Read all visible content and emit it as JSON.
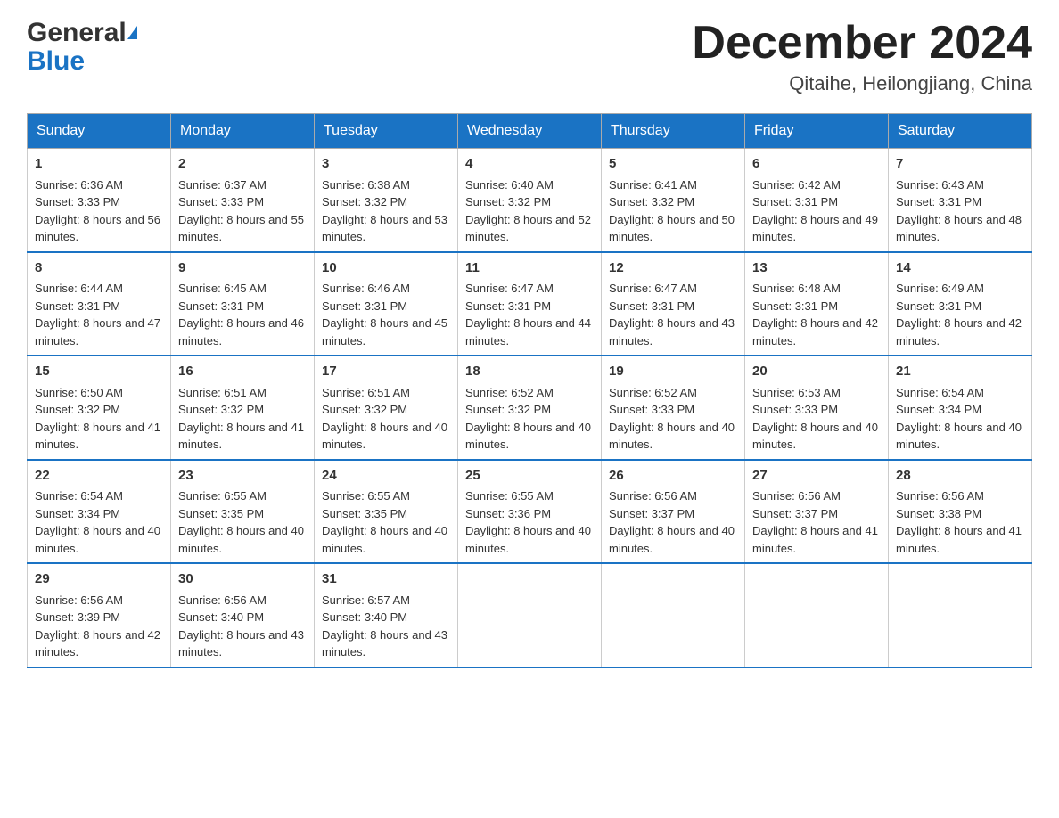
{
  "header": {
    "logo_general": "General",
    "logo_blue": "Blue",
    "month_title": "December 2024",
    "location": "Qitaihe, Heilongjiang, China"
  },
  "days_of_week": [
    "Sunday",
    "Monday",
    "Tuesday",
    "Wednesday",
    "Thursday",
    "Friday",
    "Saturday"
  ],
  "weeks": [
    [
      {
        "day": "1",
        "sunrise": "Sunrise: 6:36 AM",
        "sunset": "Sunset: 3:33 PM",
        "daylight": "Daylight: 8 hours and 56 minutes."
      },
      {
        "day": "2",
        "sunrise": "Sunrise: 6:37 AM",
        "sunset": "Sunset: 3:33 PM",
        "daylight": "Daylight: 8 hours and 55 minutes."
      },
      {
        "day": "3",
        "sunrise": "Sunrise: 6:38 AM",
        "sunset": "Sunset: 3:32 PM",
        "daylight": "Daylight: 8 hours and 53 minutes."
      },
      {
        "day": "4",
        "sunrise": "Sunrise: 6:40 AM",
        "sunset": "Sunset: 3:32 PM",
        "daylight": "Daylight: 8 hours and 52 minutes."
      },
      {
        "day": "5",
        "sunrise": "Sunrise: 6:41 AM",
        "sunset": "Sunset: 3:32 PM",
        "daylight": "Daylight: 8 hours and 50 minutes."
      },
      {
        "day": "6",
        "sunrise": "Sunrise: 6:42 AM",
        "sunset": "Sunset: 3:31 PM",
        "daylight": "Daylight: 8 hours and 49 minutes."
      },
      {
        "day": "7",
        "sunrise": "Sunrise: 6:43 AM",
        "sunset": "Sunset: 3:31 PM",
        "daylight": "Daylight: 8 hours and 48 minutes."
      }
    ],
    [
      {
        "day": "8",
        "sunrise": "Sunrise: 6:44 AM",
        "sunset": "Sunset: 3:31 PM",
        "daylight": "Daylight: 8 hours and 47 minutes."
      },
      {
        "day": "9",
        "sunrise": "Sunrise: 6:45 AM",
        "sunset": "Sunset: 3:31 PM",
        "daylight": "Daylight: 8 hours and 46 minutes."
      },
      {
        "day": "10",
        "sunrise": "Sunrise: 6:46 AM",
        "sunset": "Sunset: 3:31 PM",
        "daylight": "Daylight: 8 hours and 45 minutes."
      },
      {
        "day": "11",
        "sunrise": "Sunrise: 6:47 AM",
        "sunset": "Sunset: 3:31 PM",
        "daylight": "Daylight: 8 hours and 44 minutes."
      },
      {
        "day": "12",
        "sunrise": "Sunrise: 6:47 AM",
        "sunset": "Sunset: 3:31 PM",
        "daylight": "Daylight: 8 hours and 43 minutes."
      },
      {
        "day": "13",
        "sunrise": "Sunrise: 6:48 AM",
        "sunset": "Sunset: 3:31 PM",
        "daylight": "Daylight: 8 hours and 42 minutes."
      },
      {
        "day": "14",
        "sunrise": "Sunrise: 6:49 AM",
        "sunset": "Sunset: 3:31 PM",
        "daylight": "Daylight: 8 hours and 42 minutes."
      }
    ],
    [
      {
        "day": "15",
        "sunrise": "Sunrise: 6:50 AM",
        "sunset": "Sunset: 3:32 PM",
        "daylight": "Daylight: 8 hours and 41 minutes."
      },
      {
        "day": "16",
        "sunrise": "Sunrise: 6:51 AM",
        "sunset": "Sunset: 3:32 PM",
        "daylight": "Daylight: 8 hours and 41 minutes."
      },
      {
        "day": "17",
        "sunrise": "Sunrise: 6:51 AM",
        "sunset": "Sunset: 3:32 PM",
        "daylight": "Daylight: 8 hours and 40 minutes."
      },
      {
        "day": "18",
        "sunrise": "Sunrise: 6:52 AM",
        "sunset": "Sunset: 3:32 PM",
        "daylight": "Daylight: 8 hours and 40 minutes."
      },
      {
        "day": "19",
        "sunrise": "Sunrise: 6:52 AM",
        "sunset": "Sunset: 3:33 PM",
        "daylight": "Daylight: 8 hours and 40 minutes."
      },
      {
        "day": "20",
        "sunrise": "Sunrise: 6:53 AM",
        "sunset": "Sunset: 3:33 PM",
        "daylight": "Daylight: 8 hours and 40 minutes."
      },
      {
        "day": "21",
        "sunrise": "Sunrise: 6:54 AM",
        "sunset": "Sunset: 3:34 PM",
        "daylight": "Daylight: 8 hours and 40 minutes."
      }
    ],
    [
      {
        "day": "22",
        "sunrise": "Sunrise: 6:54 AM",
        "sunset": "Sunset: 3:34 PM",
        "daylight": "Daylight: 8 hours and 40 minutes."
      },
      {
        "day": "23",
        "sunrise": "Sunrise: 6:55 AM",
        "sunset": "Sunset: 3:35 PM",
        "daylight": "Daylight: 8 hours and 40 minutes."
      },
      {
        "day": "24",
        "sunrise": "Sunrise: 6:55 AM",
        "sunset": "Sunset: 3:35 PM",
        "daylight": "Daylight: 8 hours and 40 minutes."
      },
      {
        "day": "25",
        "sunrise": "Sunrise: 6:55 AM",
        "sunset": "Sunset: 3:36 PM",
        "daylight": "Daylight: 8 hours and 40 minutes."
      },
      {
        "day": "26",
        "sunrise": "Sunrise: 6:56 AM",
        "sunset": "Sunset: 3:37 PM",
        "daylight": "Daylight: 8 hours and 40 minutes."
      },
      {
        "day": "27",
        "sunrise": "Sunrise: 6:56 AM",
        "sunset": "Sunset: 3:37 PM",
        "daylight": "Daylight: 8 hours and 41 minutes."
      },
      {
        "day": "28",
        "sunrise": "Sunrise: 6:56 AM",
        "sunset": "Sunset: 3:38 PM",
        "daylight": "Daylight: 8 hours and 41 minutes."
      }
    ],
    [
      {
        "day": "29",
        "sunrise": "Sunrise: 6:56 AM",
        "sunset": "Sunset: 3:39 PM",
        "daylight": "Daylight: 8 hours and 42 minutes."
      },
      {
        "day": "30",
        "sunrise": "Sunrise: 6:56 AM",
        "sunset": "Sunset: 3:40 PM",
        "daylight": "Daylight: 8 hours and 43 minutes."
      },
      {
        "day": "31",
        "sunrise": "Sunrise: 6:57 AM",
        "sunset": "Sunset: 3:40 PM",
        "daylight": "Daylight: 8 hours and 43 minutes."
      },
      null,
      null,
      null,
      null
    ]
  ]
}
